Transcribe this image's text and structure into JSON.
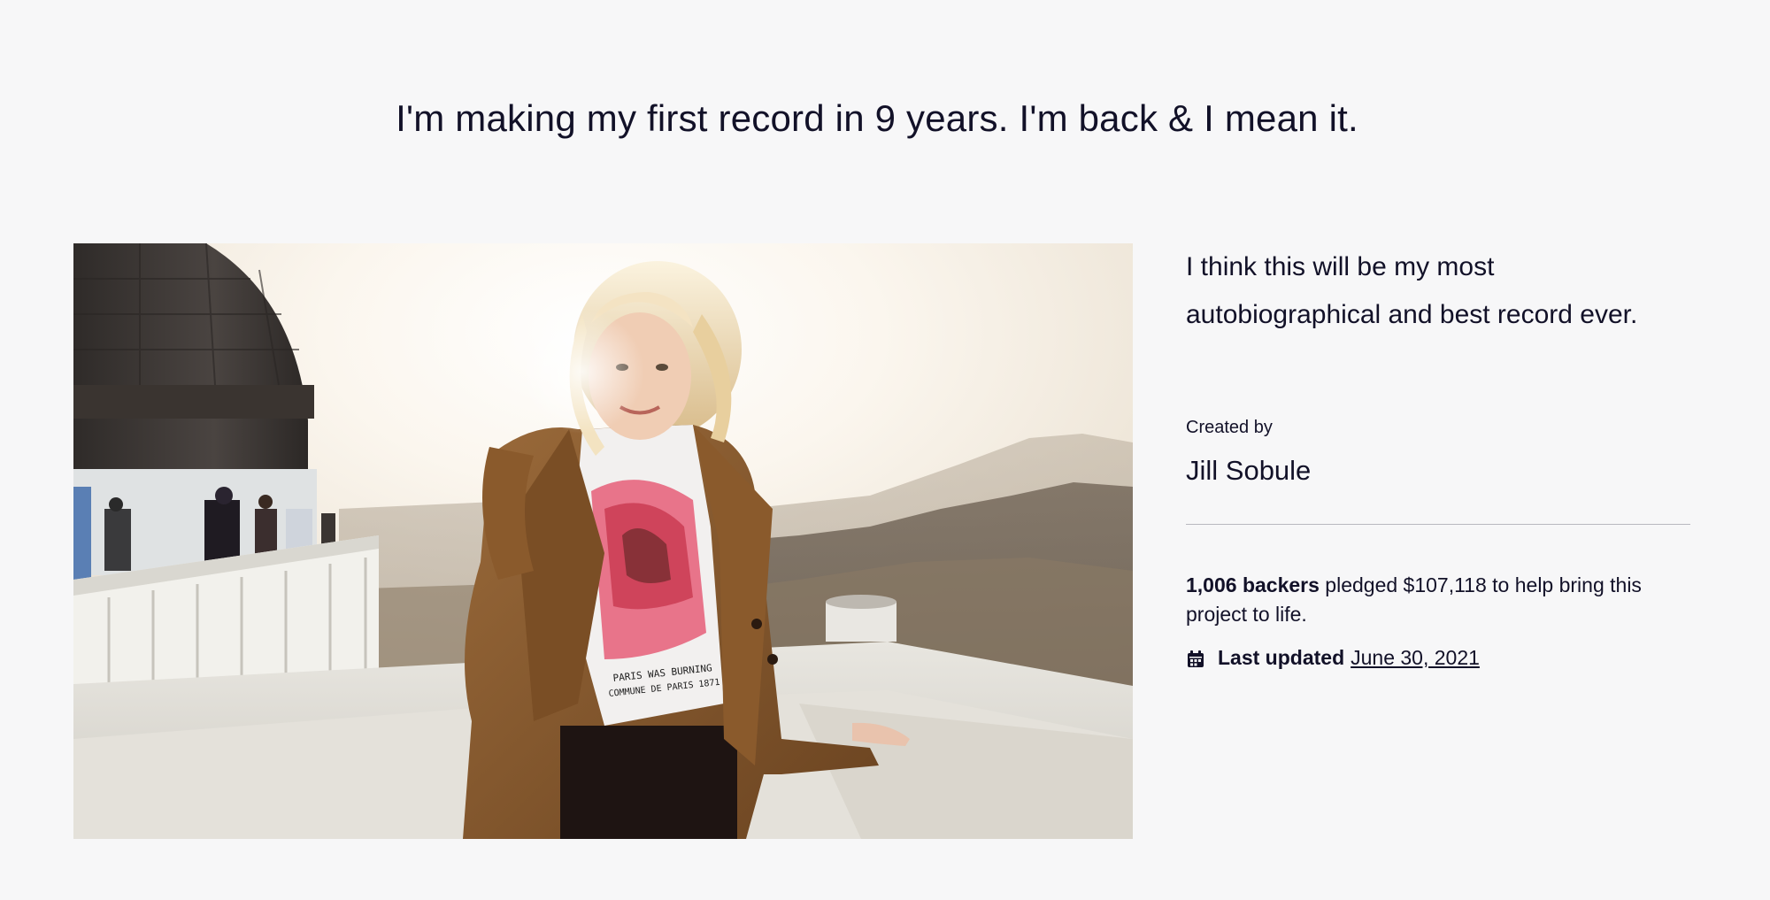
{
  "project": {
    "title": "I'm making my first record in 9 years. I'm back & I mean it.",
    "blurb": "I think this will be my most autobiographical and best record ever.",
    "created_by_label": "Created by",
    "creator_name": "Jill Sobule",
    "backers_count": "1,006 backers",
    "pledge_text": " pledged $107,118 to help bring this project to life.",
    "last_updated_label": "Last updated",
    "last_updated_date": "June 30, 2021"
  },
  "hero_image": {
    "shirt_text_line1": "PARIS WAS BURNING",
    "shirt_text_line2": "COMMUNE DE PARIS 1871"
  },
  "icons": {
    "calendar": "calendar-icon"
  },
  "colors": {
    "background": "#f7f7f8",
    "text": "#121128"
  }
}
